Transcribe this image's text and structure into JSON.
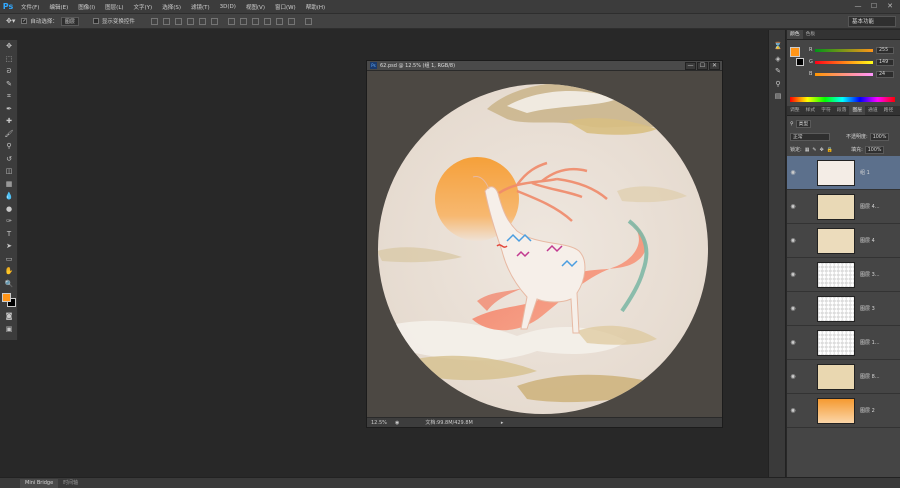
{
  "menubar": {
    "logo": "Ps",
    "items": [
      "文件(F)",
      "编辑(E)",
      "图像(I)",
      "图层(L)",
      "文字(Y)",
      "选择(S)",
      "滤镜(T)",
      "3D(D)",
      "视图(V)",
      "窗口(W)",
      "帮助(H)"
    ],
    "min": "—",
    "max": "☐",
    "close": "✕"
  },
  "options": {
    "auto_select_label": "自动选择：",
    "auto_select_value": "图层",
    "show_transform_label": "显示变换控件",
    "workspace": "基本功能"
  },
  "document": {
    "title": "62.psd @ 12.5% (组 1, RGB/8)",
    "zoom": "12.5%",
    "doc_info": "文档:99.8M/429.8M"
  },
  "colors": {
    "foreground": "#ff9518",
    "background": "#000000",
    "selection": "#5c708c"
  },
  "color_panel": {
    "tabs": [
      "颜色",
      "色板"
    ],
    "r_label": "R",
    "r_value": "255",
    "g_label": "G",
    "g_value": "149",
    "b_label": "B",
    "b_value": "24"
  },
  "layers_panel": {
    "tabs": [
      "调整",
      "样式",
      "字符",
      "段落",
      "图层",
      "通道",
      "路径"
    ],
    "kind": "类型",
    "blend": "正常",
    "opacity_label": "不透明度:",
    "opacity": "100%",
    "lock_label": "锁定:",
    "fill_label": "填充:",
    "fill": "100%",
    "layers": [
      {
        "name": "组 1",
        "selected": true
      },
      {
        "name": "图层 4...",
        "selected": false
      },
      {
        "name": "图层 4",
        "selected": false
      },
      {
        "name": "图层 3...",
        "selected": false
      },
      {
        "name": "图层 3",
        "selected": false
      },
      {
        "name": "图层 1...",
        "selected": false
      },
      {
        "name": "图层 8...",
        "selected": false
      },
      {
        "name": "图层 2",
        "selected": false
      }
    ]
  },
  "bottombar": {
    "tabs": [
      "Mini Bridge",
      "时间轴"
    ]
  }
}
